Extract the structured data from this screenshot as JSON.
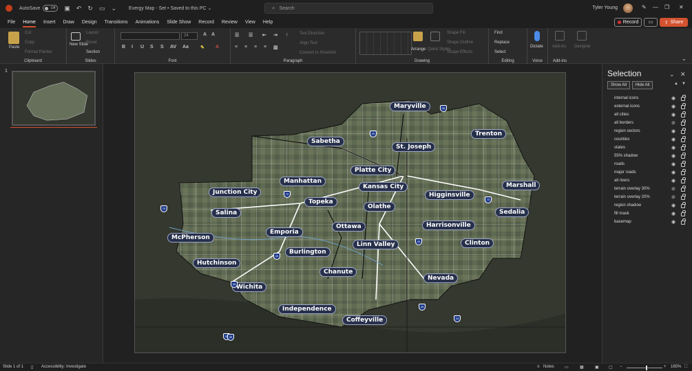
{
  "titlebar": {
    "autosave_label": "AutoSave",
    "autosave_state": "Off",
    "doc_title": "Evergy Map - Set  •  Saved to this PC  ⌄",
    "search_placeholder": "Search",
    "user_name": "Tyler Young"
  },
  "menu": [
    "File",
    "Home",
    "Insert",
    "Draw",
    "Design",
    "Transitions",
    "Animations",
    "Slide Show",
    "Record",
    "Review",
    "View",
    "Help"
  ],
  "menu_active": "Home",
  "actions": {
    "record": "Record",
    "share": "Share"
  },
  "ribbon": {
    "clipboard": {
      "label": "Clipboard",
      "paste": "Paste",
      "cut": "Cut",
      "copy": "Copy",
      "format_painter": "Format Painter"
    },
    "slides": {
      "label": "Slides",
      "new_slide": "New Slide",
      "layout": "Layout",
      "reset": "Reset",
      "section": "Section"
    },
    "font": {
      "label": "Font",
      "size": "24"
    },
    "paragraph": {
      "label": "Paragraph",
      "text_direction": "Text Direction",
      "align_text": "Align Text",
      "convert_smartart": "Convert to SmartArt"
    },
    "drawing": {
      "label": "Drawing",
      "arrange": "Arrange",
      "quick_styles": "Quick Styles",
      "shape_fill": "Shape Fill",
      "shape_outline": "Shape Outline",
      "shape_effects": "Shape Effects"
    },
    "editing": {
      "label": "Editing",
      "find": "Find",
      "replace": "Replace",
      "select": "Select"
    },
    "voice": {
      "label": "Voice",
      "dictate": "Dictate"
    },
    "addins": {
      "label": "Add-ins",
      "addins": "Add-ins",
      "designer": "Designer"
    }
  },
  "thumbnails": {
    "slide_number": "1"
  },
  "selection_pane": {
    "title": "Selection",
    "show_all": "Show All",
    "hide_all": "Hide All",
    "layers": [
      {
        "name": "internal icons",
        "visible": true
      },
      {
        "name": "external icons",
        "visible": true
      },
      {
        "name": "all cities",
        "visible": true
      },
      {
        "name": "all borders",
        "visible": false
      },
      {
        "name": "region sectors",
        "visible": true
      },
      {
        "name": "counties",
        "visible": true
      },
      {
        "name": "states",
        "visible": true
      },
      {
        "name": "55% shadow",
        "visible": true
      },
      {
        "name": "roads",
        "visible": true
      },
      {
        "name": "major roads",
        "visible": true
      },
      {
        "name": "all rivers",
        "visible": true
      },
      {
        "name": "terrain overlay 30%",
        "visible": false
      },
      {
        "name": "terrain overlay 20%",
        "visible": false
      },
      {
        "name": "region shadow",
        "visible": true
      },
      {
        "name": "fill mask",
        "visible": true
      },
      {
        "name": "basemap",
        "visible": true
      }
    ]
  },
  "map": {
    "cities": [
      "Maryville",
      "Trenton",
      "Sabetha",
      "St. Joseph",
      "Platte City",
      "Manhattan",
      "Junction City",
      "Kansas City",
      "Marshall",
      "Topeka",
      "Higginsville",
      "Salina",
      "Olathe",
      "Sedalia",
      "Ottawa",
      "Harrisonville",
      "McPherson",
      "Emporia",
      "Clinton",
      "Linn Valley",
      "Burlington",
      "Hutchinson",
      "Chanute",
      "Nevada",
      "Wichita",
      "Independence",
      "Coffeyville"
    ],
    "shields": [
      "35",
      "29",
      "70",
      "70",
      "70",
      "35",
      "49",
      "49",
      "49",
      "35",
      "44",
      "35"
    ]
  },
  "status": {
    "slide_info": "Slide 1 of 1",
    "accessibility": "Accessibility: Investigate",
    "notes": "Notes",
    "zoom": "165%"
  }
}
